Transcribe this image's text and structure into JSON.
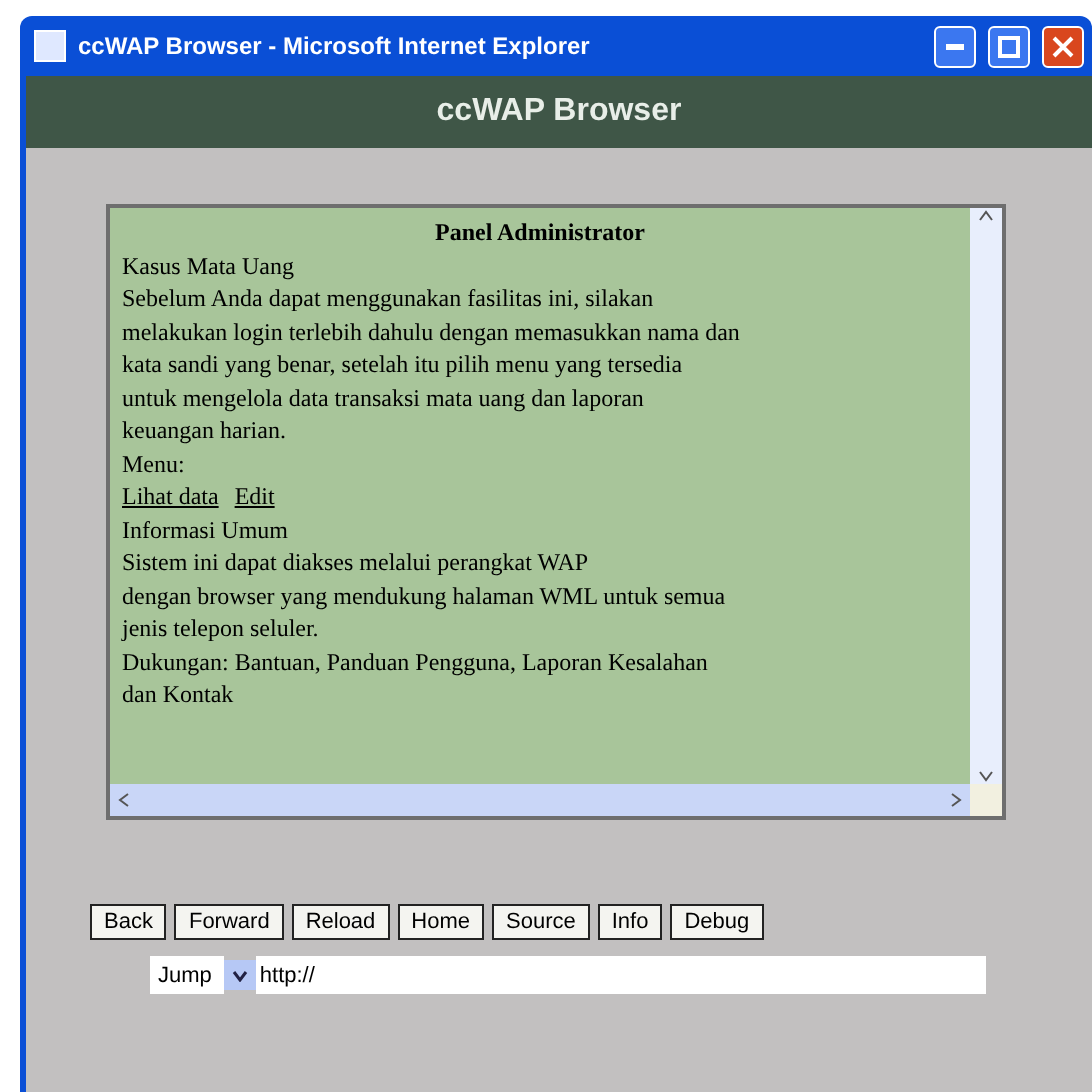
{
  "window": {
    "title": "ccWAP Browser - Microsoft Internet Explorer"
  },
  "header": {
    "title": "ccWAP Browser"
  },
  "content": {
    "title": "Panel Administrator",
    "lines": [
      {
        "kind": "text",
        "text": "Kasus Mata Uang"
      },
      {
        "kind": "text",
        "text": "Sebelum Anda dapat menggunakan fasilitas ini, silakan"
      },
      {
        "kind": "text",
        "text": "melakukan login terlebih dahulu dengan memasukkan nama dan"
      },
      {
        "kind": "text",
        "text": "kata sandi yang benar, setelah itu pilih menu yang tersedia"
      },
      {
        "kind": "text",
        "text": "untuk mengelola data transaksi mata uang dan laporan"
      },
      {
        "kind": "text",
        "text": "keuangan harian."
      },
      {
        "kind": "text",
        "text": "Menu:"
      },
      {
        "kind": "links",
        "links": [
          "Lihat data",
          "Edit"
        ]
      },
      {
        "kind": "text",
        "text": "Informasi Umum"
      },
      {
        "kind": "text",
        "text": "Sistem ini dapat diakses melalui perangkat WAP"
      },
      {
        "kind": "text",
        "text": "dengan browser yang mendukung halaman WML untuk semua"
      },
      {
        "kind": "text",
        "text": "jenis telepon seluler."
      },
      {
        "kind": "text",
        "text": "Dukungan: Bantuan, Panduan Pengguna, Laporan Kesalahan"
      },
      {
        "kind": "text",
        "text": "dan Kontak"
      }
    ]
  },
  "buttons": [
    "Back",
    "Forward",
    "Reload",
    "Home",
    "Source",
    "Info",
    "Debug"
  ],
  "jump": {
    "label": "Jump",
    "value": "http://"
  }
}
